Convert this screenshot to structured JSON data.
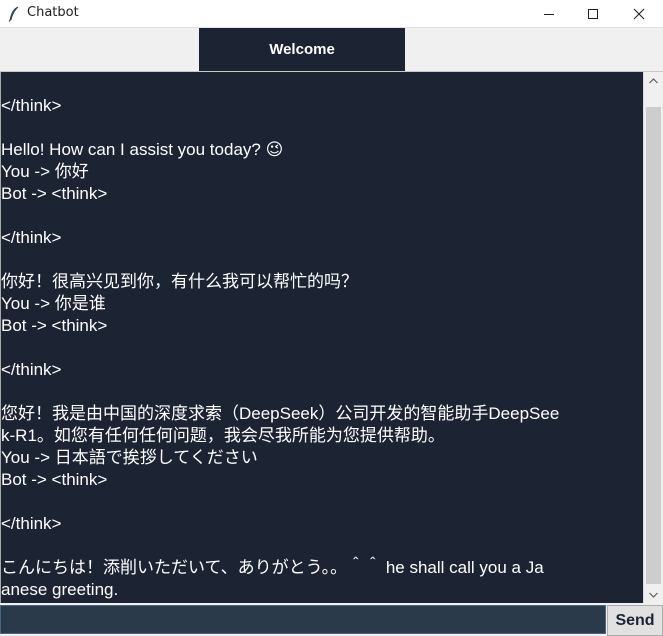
{
  "window": {
    "title": "Chatbot",
    "icon": "feather-icon",
    "controls": [
      "minimize-icon",
      "maximize-icon",
      "close-icon"
    ]
  },
  "header": {
    "tab_label": "Welcome"
  },
  "chat": {
    "lines": [
      "</think>",
      "",
      "Hello! How can I assist you today? 😉",
      "You -> 你好",
      "Bot -> <think>",
      "",
      "</think>",
      "",
      "你好！很高兴见到你，有什么我可以帮忙的吗？",
      "You -> 你是谁",
      "Bot -> <think>",
      "",
      "</think>",
      "",
      "您好！我是由中国的深度求索（DeepSeek）公司开发的智能助手DeepSeek-R1。如您有任何任何问题，我会尽我所能为您提供帮助。",
      "k-R1。如您有任何任何问题，我会尽我所能为您提供帮助。",
      "You -> 日本語で挨拶してください",
      "Bot -> <think>",
      "",
      "</think>",
      "",
      "こんにちは！添削いただいて、ありがとう。。＾＾ he shall call you a Japanese greeting.",
      "anese greeting."
    ]
  },
  "input": {
    "value": "",
    "placeholder": ""
  },
  "send_label": "Send",
  "colors": {
    "chat_bg": "#1c2333",
    "input_bg": "#2b3a4a",
    "text": "#ffffff"
  }
}
